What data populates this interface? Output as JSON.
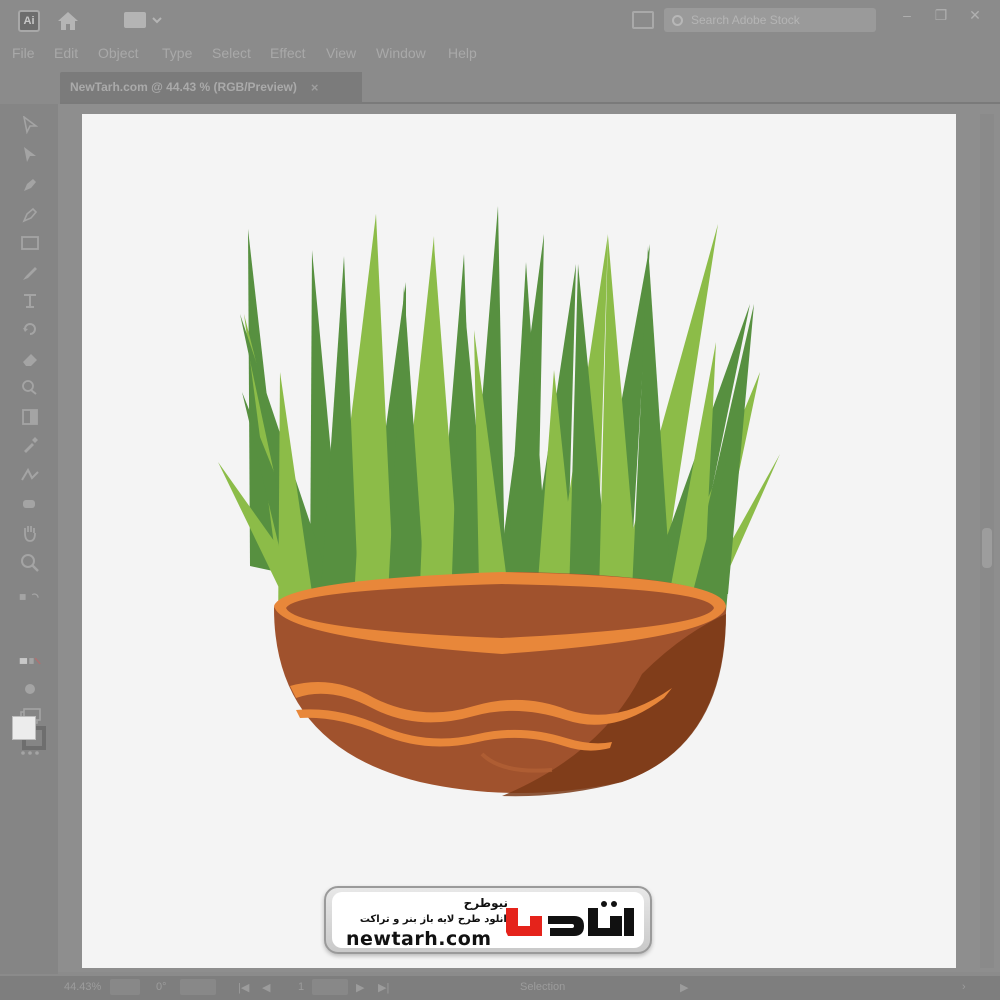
{
  "app": {
    "logo_text": "Ai",
    "search_placeholder": "Search Adobe Stock"
  },
  "menu": [
    "File",
    "Edit",
    "Object",
    "Type",
    "Select",
    "Effect",
    "View",
    "Window",
    "Help"
  ],
  "document_tab": {
    "title": "NewTarh.com @ 44.43 % (RGB/Preview)",
    "close": "×"
  },
  "window_controls": {
    "minimize": "–",
    "restore": "❐",
    "close": "✕"
  },
  "status_bar": {
    "zoom": "44.43%",
    "rotation": "0°",
    "artboard_number": "1",
    "tool": "Selection"
  },
  "watermark": {
    "title": "نیوطرح",
    "tagline": "دانلود طرح لایه باز بنر و تراکت",
    "domain": "newtarh.com",
    "logo_text": "نیوطرح",
    "logo_color": "#e5231b"
  },
  "colors": {
    "grass_dark": "#579040",
    "grass_light": "#8cbc48",
    "bowl_body": "#a0522d",
    "bowl_shadow": "#7a3a17",
    "bowl_rim": "#e8873a",
    "bowl_stripe": "#e8873a"
  }
}
